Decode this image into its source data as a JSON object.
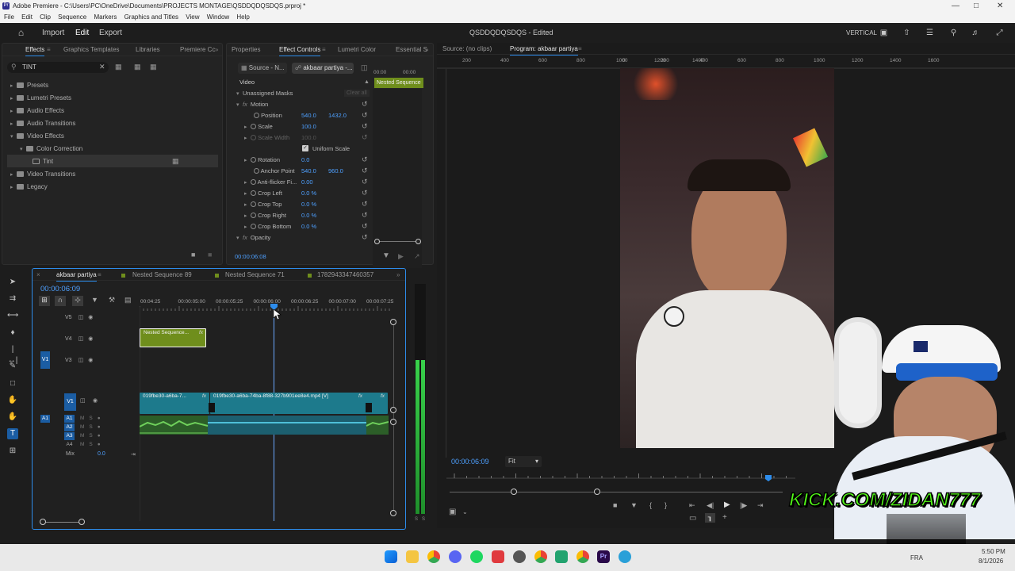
{
  "window": {
    "title": "Adobe Premiere - C:\\Users\\PC\\OneDrive\\Documents\\PROJECTS MONTAGE\\QSDDQDQSDQS.prproj *"
  },
  "menu": [
    "File",
    "Edit",
    "Clip",
    "Sequence",
    "Markers",
    "Graphics and Titles",
    "View",
    "Window",
    "Help"
  ],
  "header": {
    "import": "Import",
    "edit": "Edit",
    "export": "Export",
    "project_title": "QSDDQDQSDQS - Edited",
    "layout": "VERTICAL"
  },
  "effects_panel": {
    "tabs": [
      "Effects",
      "Graphics Templates",
      "Libraries",
      "Premiere Cc"
    ],
    "search_value": "TINT",
    "tree": [
      {
        "label": "Presets",
        "level": 0
      },
      {
        "label": "Lumetri Presets",
        "level": 0
      },
      {
        "label": "Audio Effects",
        "level": 0
      },
      {
        "label": "Audio Transitions",
        "level": 0
      },
      {
        "label": "Video Effects",
        "level": 0
      },
      {
        "label": "Color Correction",
        "level": 1
      },
      {
        "label": "Tint",
        "level": 2
      },
      {
        "label": "Video Transitions",
        "level": 0
      },
      {
        "label": "Legacy",
        "level": 0
      }
    ]
  },
  "effect_controls": {
    "tabs": [
      "Properties",
      "Effect Controls",
      "Lumetri Color",
      "Essential S"
    ],
    "source_chip": "Source - N...",
    "seq_chip": "akbaar partiya -...",
    "mini_time_a": "00:00",
    "mini_time_b": "00:00",
    "nested_label": "Nested Sequence",
    "video_label": "Video",
    "masks": "Unassigned Masks",
    "clear_all": "Clear all",
    "motion": "Motion",
    "position": {
      "label": "Position",
      "x": "540.0",
      "y": "1432.0"
    },
    "scale": {
      "label": "Scale",
      "v": "100.0"
    },
    "scale_width": {
      "label": "Scale Width",
      "v": "100.0"
    },
    "uniform": "Uniform Scale",
    "rotation": {
      "label": "Rotation",
      "v": "0.0"
    },
    "anchor": {
      "label": "Anchor Point",
      "x": "540.0",
      "y": "960.0"
    },
    "antiflicker": {
      "label": "Anti-flicker Fi...",
      "v": "0.00"
    },
    "crop_left": {
      "label": "Crop Left",
      "v": "0.0 %"
    },
    "crop_top": {
      "label": "Crop Top",
      "v": "0.0 %"
    },
    "crop_right": {
      "label": "Crop Right",
      "v": "0.0 %"
    },
    "crop_bottom": {
      "label": "Crop Bottom",
      "v": "0.0 %"
    },
    "opacity": "Opacity",
    "timecode": "00:00:06:08"
  },
  "monitor": {
    "source_tab": "Source: (no clips)",
    "program_tab": "Program: akbaar partiya",
    "ruler": [
      "200",
      "400",
      "600",
      "800",
      "1000",
      "1200",
      "1400",
      "0",
      "200",
      "400",
      "600",
      "800",
      "1000",
      "1200",
      "1400",
      "1600"
    ],
    "timecode": "00:00:06:09",
    "fit": "Fit"
  },
  "timeline": {
    "tabs": [
      "akbaar partiya",
      "Nested Sequence 89",
      "Nested Sequence 71",
      "1782943347460357"
    ],
    "timecode": "00:00:06:09",
    "ruler": [
      "00:04:25",
      "00:00:05:00",
      "00:00:05:25",
      "00:00:06:00",
      "00:00:06:25",
      "00:00:07:00",
      "00:00:07:25"
    ],
    "tracks_v": [
      "V5",
      "V4",
      "V3",
      "V1"
    ],
    "tracks_a": [
      "A1",
      "A2",
      "A3",
      "A4"
    ],
    "src_v": "V1",
    "src_a": "A1",
    "mix": "Mix",
    "mix_val": "0.0",
    "nested_clip": "Nested Sequence...",
    "clip1": "019fbe30-a6ba-7...",
    "clip2": "019fbe30-a6ba-74ba-8f88-327b901ee8e4.mp4 [V]",
    "fx": "fx"
  },
  "meter": {
    "s1": "S",
    "s2": "S"
  },
  "overlay": {
    "kick": "KICK.COM/ZIDAN777"
  },
  "tray": {
    "lang": "FRA",
    "time": "5:50 PM",
    "date": "8/1/2026"
  },
  "colors": {
    "accent": "#2d8ceb",
    "clip_teal": "#1d7a8c",
    "clip_green": "#6f8e1c",
    "audio_green": "#5cb944",
    "kick_green": "#53fc18"
  }
}
